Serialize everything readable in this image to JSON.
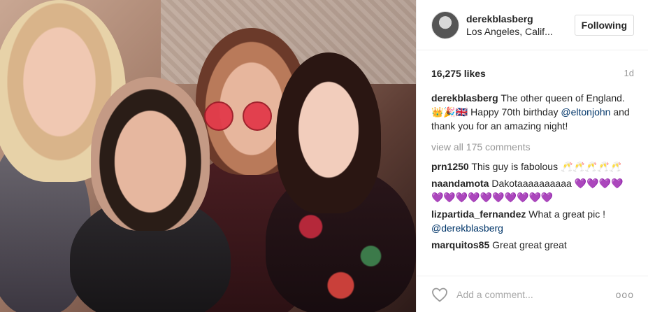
{
  "post": {
    "username": "derekblasberg",
    "location": "Los Angeles, Calif...",
    "follow_label": "Following",
    "likes": "16,275 likes",
    "time": "1d",
    "caption_user": "derekblasberg",
    "caption_text_1": " The other queen of England. 👑🎉🇬🇧 Happy 70th birthday ",
    "caption_mention_1": "@eltonjohn",
    "caption_text_2": " and thank you for an amazing night!",
    "view_all": "view all 175 comments",
    "add_comment_placeholder": "Add a comment...",
    "more_label": "ooo"
  },
  "comments": [
    {
      "user": "prn1250",
      "text": " This guy is fabolous 🥂🥂🥂🥂🥂",
      "mention": ""
    },
    {
      "user": "naandamota",
      "text": " Dakotaaaaaaaaaa 💜💜💜💜💜💜💜💜💜💜💜💜💜💜",
      "mention": ""
    },
    {
      "user": "lizpartida_fernandez",
      "text": " What a great pic ! ",
      "mention": "@derekblasberg"
    },
    {
      "user": "marquitos85",
      "text": " Great great great",
      "mention": ""
    }
  ],
  "colors": {
    "accent": "#003569",
    "muted": "#999999",
    "border": "#efefef"
  },
  "icons": {
    "like": "heart-icon",
    "more": "more-options-icon"
  }
}
